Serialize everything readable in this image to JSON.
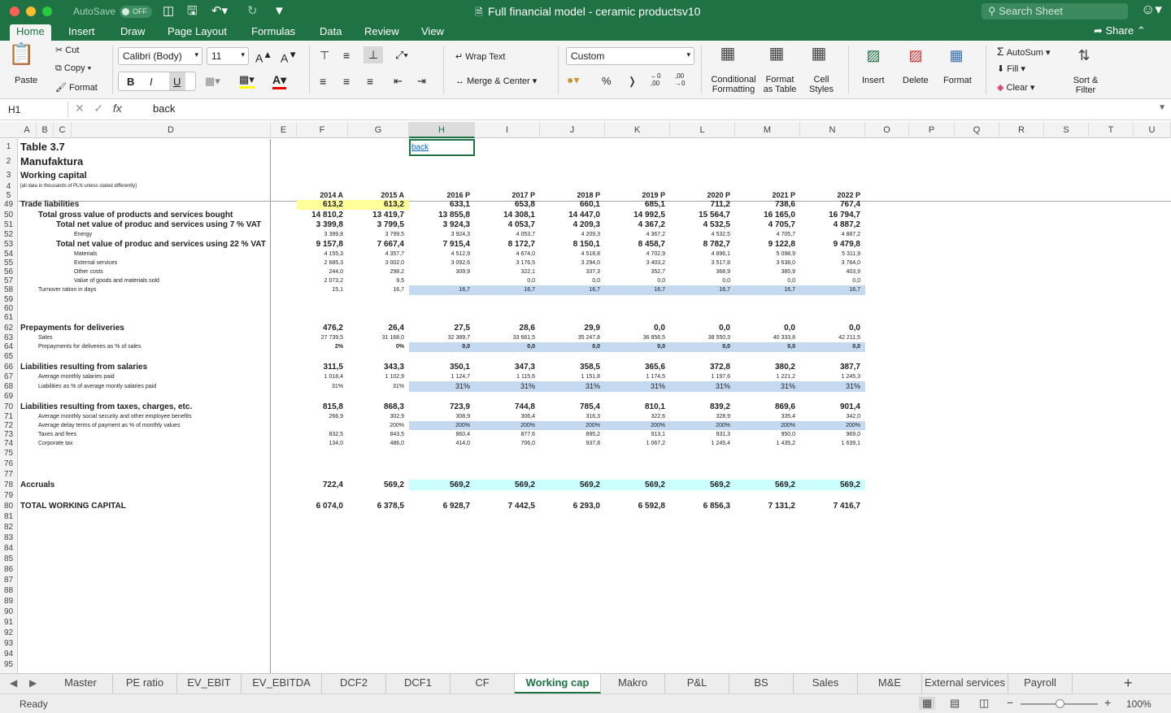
{
  "window": {
    "title": "Full financial model - ceramic productsv10",
    "autosave_label": "AutoSave",
    "autosave_state": "OFF",
    "search_placeholder": "Search Sheet"
  },
  "ribbon_tabs": [
    "Home",
    "Insert",
    "Draw",
    "Page Layout",
    "Formulas",
    "Data",
    "Review",
    "View"
  ],
  "active_ribbon_tab": "Home",
  "share_label": "Share",
  "ribbon": {
    "paste": "Paste",
    "cut": "Cut",
    "copy": "Copy",
    "format_painter": "Format",
    "font_name": "Calibri (Body)",
    "font_size": "11",
    "bold": "B",
    "italic": "I",
    "underline": "U",
    "wrap_text": "Wrap Text",
    "merge_center": "Merge & Center",
    "number_format": "Custom",
    "percent": "%",
    "comma": "❭",
    "conditional_formatting": "Conditional Formatting",
    "format_as_table": "Format as Table",
    "cell_styles": "Cell Styles",
    "insert": "Insert",
    "delete": "Delete",
    "format": "Format",
    "autosum": "AutoSum",
    "fill": "Fill",
    "clear": "Clear",
    "sort_filter": "Sort & Filter"
  },
  "formula_bar": {
    "name_box": "H1",
    "fx": "fx",
    "value": "back"
  },
  "columns": [
    "A",
    "B",
    "C",
    "D",
    "E",
    "F",
    "G",
    "H",
    "I",
    "J",
    "K",
    "L",
    "M",
    "N",
    "O",
    "P",
    "Q",
    "R",
    "S",
    "T",
    "U"
  ],
  "selected_column": "H",
  "row_numbers": [
    "1",
    "2",
    "3",
    "4",
    "5",
    "49",
    "50",
    "51",
    "52",
    "53",
    "54",
    "55",
    "56",
    "57",
    "58",
    "59",
    "60",
    "61",
    "62",
    "63",
    "64",
    "65",
    "66",
    "67",
    "68",
    "69",
    "70",
    "71",
    "72",
    "73",
    "74",
    "75",
    "76",
    "77",
    "78",
    "79",
    "80",
    "81",
    "82",
    "83",
    "84",
    "85",
    "86",
    "87",
    "88",
    "89",
    "90",
    "91",
    "92",
    "93",
    "94",
    "95"
  ],
  "sheet": {
    "title1": "Table 3.7",
    "title2": "Manufaktura",
    "title3": "Working capital",
    "note": "[all data in thousands of PLN unless stated differently]",
    "link": "back",
    "years": [
      "2014 A",
      "2015 A",
      "2016 P",
      "2017 P",
      "2018 P",
      "2019 P",
      "2020 P",
      "2021 P",
      "2022 P"
    ],
    "rows": [
      {
        "r": "49",
        "label": "Trade liabilities",
        "style": "lbl",
        "indent": 0,
        "vstyle": "v",
        "values": [
          "613,2",
          "613,2",
          "633,1",
          "653,8",
          "660,1",
          "685,1",
          "711,2",
          "738,6",
          "767,4"
        ],
        "hl": "yellow"
      },
      {
        "r": "50",
        "label": "Total gross value of products and services bought",
        "style": "lbl",
        "indent": 22,
        "vstyle": "v",
        "values": [
          "14 810,2",
          "13 419,7",
          "13 855,8",
          "14 308,1",
          "14 447,0",
          "14 992,5",
          "15 564,7",
          "16 165,0",
          "16 794,7"
        ]
      },
      {
        "r": "51",
        "label": "Total net value of produc and services using 7 % VAT",
        "style": "lbl",
        "indent": 44,
        "vstyle": "v",
        "values": [
          "3 399,8",
          "3 799,5",
          "3 924,3",
          "4 053,7",
          "4 209,3",
          "4 367,2",
          "4 532,5",
          "4 705,7",
          "4 887,2"
        ]
      },
      {
        "r": "52",
        "label": "Energy",
        "style": "lbls",
        "indent": 66,
        "vstyle": "vs",
        "values": [
          "3 399,8",
          "3 799,5",
          "3 924,3",
          "4 053,7",
          "4 209,3",
          "4 367,2",
          "4 532,5",
          "4 705,7",
          "4 887,2"
        ]
      },
      {
        "r": "53",
        "label": "Total net value of produc and services using 22 % VAT",
        "style": "lbl",
        "indent": 44,
        "vstyle": "v",
        "values": [
          "9 157,8",
          "7 667,4",
          "7 915,4",
          "8 172,7",
          "8 150,1",
          "8 458,7",
          "8 782,7",
          "9 122,8",
          "9 479,8"
        ]
      },
      {
        "r": "54",
        "label": "Materials",
        "style": "lbls",
        "indent": 66,
        "vstyle": "vs",
        "values": [
          "4 155,3",
          "4 357,7",
          "4 512,9",
          "4 674,0",
          "4 518,8",
          "4 702,9",
          "4 896,1",
          "5 098,9",
          "5 311,9"
        ]
      },
      {
        "r": "55",
        "label": "External services",
        "style": "lbls",
        "indent": 66,
        "vstyle": "vs",
        "values": [
          "2 685,3",
          "3 002,0",
          "3 092,6",
          "3 176,5",
          "3 294,0",
          "3 403,2",
          "3 517,8",
          "3 638,0",
          "3 764,0"
        ]
      },
      {
        "r": "56",
        "label": "Other costs",
        "style": "lbls",
        "indent": 66,
        "vstyle": "vs",
        "values": [
          "244,0",
          "298,2",
          "309,9",
          "322,1",
          "337,3",
          "352,7",
          "368,9",
          "385,9",
          "403,9"
        ]
      },
      {
        "r": "57",
        "label": "Value of goods and materials sold",
        "style": "lbls",
        "indent": 66,
        "vstyle": "vs",
        "values": [
          "2 073,2",
          "9,5",
          "",
          "0,0",
          "0,0",
          "0,0",
          "0,0",
          "0,0",
          "0,0"
        ]
      },
      {
        "r": "58",
        "label": "Turnover ration in days",
        "style": "lbls",
        "indent": 22,
        "vstyle": "vs",
        "values": [
          "15,1",
          "16,7",
          "16,7",
          "16,7",
          "16,7",
          "16,7",
          "16,7",
          "16,7",
          "16,7"
        ],
        "hl": "blue"
      },
      {
        "r": "62",
        "label": "Prepayments for deliveries",
        "style": "lbl",
        "indent": 0,
        "vstyle": "v",
        "values": [
          "476,2",
          "26,4",
          "27,5",
          "28,6",
          "29,9",
          "0,0",
          "0,0",
          "0,0",
          "0,0"
        ]
      },
      {
        "r": "63",
        "label": "Sales",
        "style": "lbls",
        "indent": 22,
        "vstyle": "vs",
        "values": [
          "27 739,5",
          "31 168,0",
          "32 389,7",
          "33 661,5",
          "35 247,8",
          "36 856,5",
          "38 550,3",
          "40 333,8",
          "42 211,5"
        ]
      },
      {
        "r": "64",
        "label": "Prepayments for deliveries as % of sales",
        "style": "lbls",
        "indent": 22,
        "vstyle": "vs",
        "values": [
          "2%",
          "0%",
          "0,0",
          "0,0",
          "0,0",
          "0,0",
          "0,0",
          "0,0",
          "0,0"
        ],
        "hl": "blue",
        "boldvals": true
      },
      {
        "r": "66",
        "label": "Liabilities resulting from salaries",
        "style": "lbl",
        "indent": 0,
        "vstyle": "v",
        "values": [
          "311,5",
          "343,3",
          "350,1",
          "347,3",
          "358,5",
          "365,6",
          "372,8",
          "380,2",
          "387,7"
        ]
      },
      {
        "r": "67",
        "label": "Average monthly salaries paid",
        "style": "lbls",
        "indent": 22,
        "vstyle": "vs",
        "values": [
          "1 018,4",
          "1 102,9",
          "1 124,7",
          "1 115,6",
          "1 151,8",
          "1 174,5",
          "1 197,6",
          "1 221,2",
          "1 245,3"
        ]
      },
      {
        "r": "68",
        "label": "Liabilities as % of average montly salaries paid",
        "style": "lbls",
        "indent": 22,
        "vstyle": "vs",
        "values": [
          "31%",
          "31%",
          "31%",
          "31%",
          "31%",
          "31%",
          "31%",
          "31%",
          "31%"
        ],
        "hl": "blue",
        "bigvals": true
      },
      {
        "r": "70",
        "label": "Liabilities resulting from taxes, charges, etc.",
        "style": "lbl",
        "indent": 0,
        "vstyle": "v",
        "values": [
          "815,8",
          "868,3",
          "723,9",
          "744,8",
          "785,4",
          "810,1",
          "839,2",
          "869,6",
          "901,4"
        ]
      },
      {
        "r": "71",
        "label": "Average monthly social security and other employee benefits",
        "style": "lbls",
        "indent": 22,
        "vstyle": "vs",
        "values": [
          "266,9",
          "302,9",
          "308,9",
          "306,4",
          "316,3",
          "322,6",
          "328,9",
          "335,4",
          "342,0"
        ]
      },
      {
        "r": "72",
        "label": "Average delay terms of payment as % of monthly values",
        "style": "lbls",
        "indent": 22,
        "vstyle": "vs",
        "values": [
          "",
          "200%",
          "200%",
          "200%",
          "200%",
          "200%",
          "200%",
          "200%",
          "200%"
        ],
        "hl": "blue"
      },
      {
        "r": "73",
        "label": "Taxes and fees",
        "style": "lbls",
        "indent": 22,
        "vstyle": "vs",
        "values": [
          "832,5",
          "843,5",
          "860,4",
          "877,6",
          "895,2",
          "913,1",
          "931,3",
          "950,0",
          "969,0"
        ]
      },
      {
        "r": "74",
        "label": "Corporate tax",
        "style": "lbls",
        "indent": 22,
        "vstyle": "vs",
        "values": [
          "134,0",
          "486,0",
          "414,0",
          "706,0",
          "937,8",
          "1 067,2",
          "1 245,4",
          "1 435,2",
          "1 639,1"
        ]
      },
      {
        "r": "78",
        "label": "Accruals",
        "style": "lbl",
        "indent": 0,
        "vstyle": "v",
        "values": [
          "722,4",
          "569,2",
          "569,2",
          "569,2",
          "569,2",
          "569,2",
          "569,2",
          "569,2",
          "569,2"
        ],
        "hl": "cyan"
      },
      {
        "r": "80",
        "label": "TOTAL WORKING CAPITAL",
        "style": "lbl",
        "indent": 0,
        "vstyle": "v",
        "values": [
          "6 074,0",
          "6 378,5",
          "6 928,7",
          "7 442,5",
          "6 293,0",
          "6 592,8",
          "6 856,3",
          "7 131,2",
          "7 416,7"
        ]
      }
    ]
  },
  "sheet_tabs": [
    "Master",
    "PE ratio",
    "EV_EBIT",
    "EV_EBITDA",
    "DCF2",
    "DCF1",
    "CF",
    "Working cap",
    "Makro",
    "P&L",
    "BS",
    "Sales",
    "M&E",
    "External services",
    "Payroll"
  ],
  "active_sheet": "Working cap",
  "status": {
    "ready": "Ready",
    "zoom": "100%",
    "zoom_level": 1.0
  },
  "colors": {
    "accent": "#1f7244",
    "highlight_yellow": "#ffff99",
    "highlight_blue": "#c5d9f1",
    "highlight_cyan": "#ccffff"
  }
}
